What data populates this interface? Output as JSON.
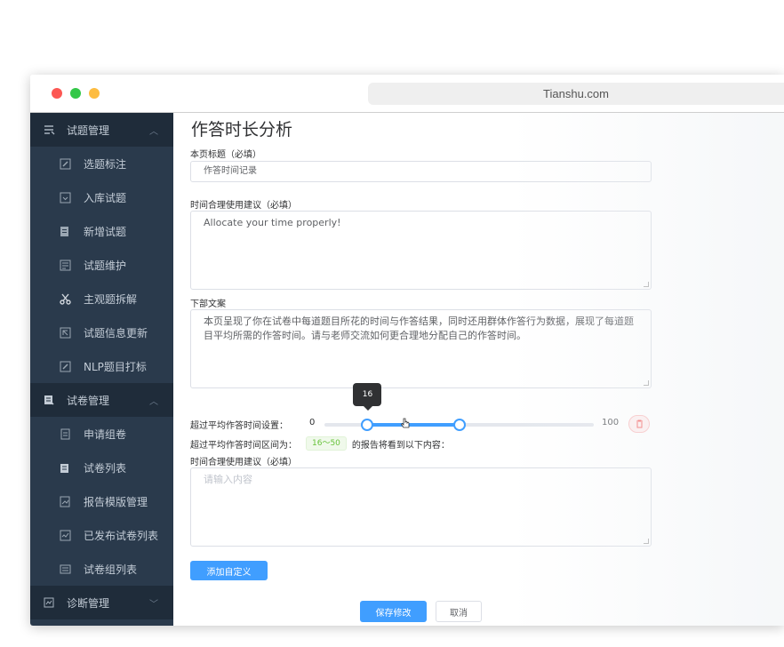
{
  "browser": {
    "url": "Tianshu.com"
  },
  "sidebar": {
    "groups": [
      {
        "label": "试题管理",
        "icon": "exam-list-icon",
        "expanded": true,
        "items": [
          {
            "label": "选题标注",
            "icon": "edit-icon"
          },
          {
            "label": "入库试题",
            "icon": "import-icon"
          },
          {
            "label": "新增试题",
            "icon": "add-doc-icon"
          },
          {
            "label": "试题维护",
            "icon": "doc-maintain-icon"
          },
          {
            "label": "主观题拆解",
            "icon": "scissors-icon"
          },
          {
            "label": "试题信息更新",
            "icon": "update-icon"
          },
          {
            "label": "NLP题目打标",
            "icon": "tag-edit-icon"
          }
        ]
      },
      {
        "label": "试卷管理",
        "icon": "paper-icon",
        "expanded": true,
        "items": [
          {
            "label": "申请组卷",
            "icon": "apply-icon"
          },
          {
            "label": "试卷列表",
            "icon": "paper-list-icon"
          },
          {
            "label": "报告模版管理",
            "icon": "report-template-icon"
          },
          {
            "label": "已发布试卷列表",
            "icon": "published-icon"
          },
          {
            "label": "试卷组列表",
            "icon": "paper-group-icon"
          }
        ]
      },
      {
        "label": "诊断管理",
        "icon": "diagnosis-icon",
        "expanded": false
      }
    ]
  },
  "main": {
    "title": "作答时长分析",
    "page_title_label": "本页标题（必填）",
    "page_title_value": "作答时间记录",
    "advice_label": "时间合理使用建议（必填）",
    "advice_value": "Allocate your time properly!",
    "footer_label": "下部文案",
    "footer_value": "本页呈现了你在试卷中每道题目所花的时间与作答结果，同时还用群体作答行为数据，展现了每道题目平均所需的作答时间。请与老师交流如何更合理地分配自己的作答时间。",
    "slider": {
      "label": "超过平均作答时间设置：",
      "min_label": "0",
      "max_label": "100",
      "min": 0,
      "max": 100,
      "low": 16,
      "high": 50,
      "tooltip": "16"
    },
    "range_prefix": "超过平均作答时间区间为：",
    "range_tag": "16～50",
    "range_suffix": "的报告将看到以下内容：",
    "advice2_label": "时间合理使用建议（必填）",
    "advice2_placeholder": "请输入内容",
    "add_custom_button": "添加自定义",
    "save_button": "保存修改",
    "cancel_button": "取消"
  },
  "colors": {
    "primary": "#409eff",
    "sidebar_bg": "#2a3a4c",
    "danger": "#f56c6c",
    "success": "#67c23a"
  }
}
